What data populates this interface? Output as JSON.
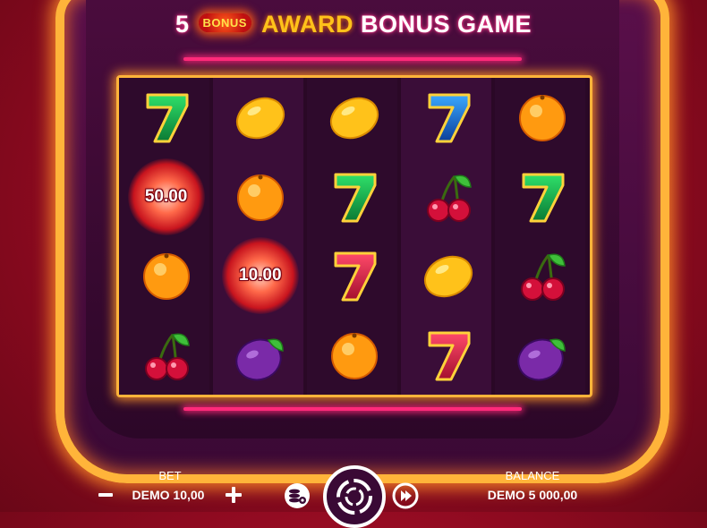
{
  "header": {
    "count": "5",
    "badge": "BONUS",
    "award": "AWARD",
    "rest": "BONUS GAME"
  },
  "grid": {
    "rows": [
      [
        {
          "type": "seven",
          "color": "green"
        },
        {
          "type": "lemon"
        },
        {
          "type": "lemon"
        },
        {
          "type": "seven",
          "color": "blue"
        },
        {
          "type": "orange"
        }
      ],
      [
        {
          "type": "coin",
          "value": "50.00"
        },
        {
          "type": "orange"
        },
        {
          "type": "seven",
          "color": "green"
        },
        {
          "type": "cherry"
        },
        {
          "type": "seven",
          "color": "green"
        }
      ],
      [
        {
          "type": "orange"
        },
        {
          "type": "coin",
          "value": "10.00"
        },
        {
          "type": "seven",
          "color": "red"
        },
        {
          "type": "lemon"
        },
        {
          "type": "cherry"
        }
      ],
      [
        {
          "type": "cherry"
        },
        {
          "type": "plum"
        },
        {
          "type": "orange"
        },
        {
          "type": "seven",
          "color": "red"
        },
        {
          "type": "plum"
        }
      ]
    ]
  },
  "bet": {
    "label": "BET",
    "value": "DEMO 10,00"
  },
  "balance": {
    "label": "BALANCE",
    "value": "DEMO 5 000,00"
  },
  "controls": {
    "minus_icon": "minus-icon",
    "plus_icon": "plus-icon",
    "autoplay_icon": "coin-stack-settings-icon",
    "spin_icon": "spin-icon",
    "turbo_icon": "fast-forward-circle-icon"
  },
  "colors": {
    "frame": "#ffb43a",
    "neon_pink": "#ff2a7a",
    "award_yellow": "#ffc21a",
    "background": "#b81430"
  }
}
